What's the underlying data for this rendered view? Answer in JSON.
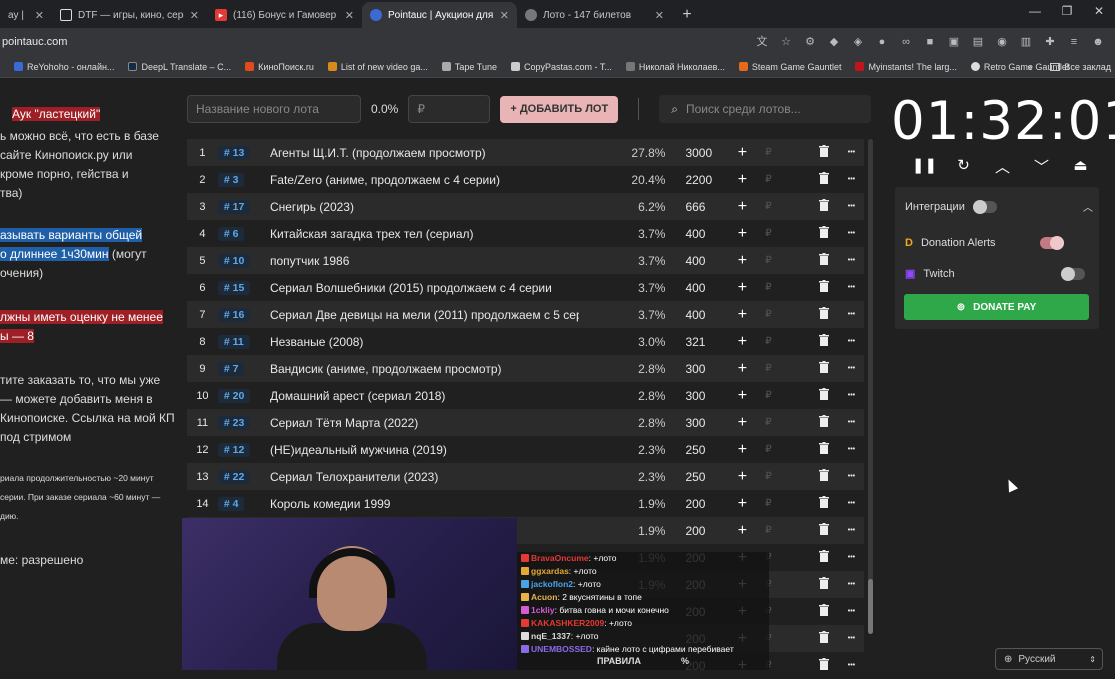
{
  "browser": {
    "tabs": [
      {
        "label": "ay |",
        "color": "#555",
        "icon": "tab-icon"
      },
      {
        "label": "DTF — игры, кино, сериалы, р",
        "color": "#222",
        "icon": "dtf-icon"
      },
      {
        "label": "(116) Бонус и Гамовер - главн",
        "color": "#e53935",
        "icon": "youtube-icon"
      },
      {
        "label": "Pointauc | Аукцион для стрим",
        "color": "#3b6ad4",
        "icon": "pointauc-icon"
      },
      {
        "label": "Лото - 147 билетов",
        "color": "#777",
        "icon": "globe-icon"
      }
    ],
    "new_tab": "+",
    "url": "pointauc.com",
    "bookmarks": [
      {
        "label": "ReYohoho - онлайн...",
        "color": "#3b6ad4"
      },
      {
        "label": "DeepL Translate – С...",
        "color": "#0f2b46"
      },
      {
        "label": "КиноПоиск.ru",
        "color": "#e34a1b"
      },
      {
        "label": "List of new video ga...",
        "color": "#d98b1a"
      },
      {
        "label": "Tape Tune",
        "color": "#aaa"
      },
      {
        "label": "CopyPastas.com - T...",
        "color": "#ccc"
      },
      {
        "label": "Николай Николаев...",
        "color": "#777"
      },
      {
        "label": "Steam Game Gauntlet",
        "color": "#e56a1b"
      },
      {
        "label": "Myinstants! The larg...",
        "color": "#c0161b"
      },
      {
        "label": "Retro Game Gauntlet",
        "color": "#ddd"
      }
    ],
    "bookmarks_more": "»",
    "all_bookmarks": "Все заклад"
  },
  "rules": {
    "title": "Аук \"ластецкий\"",
    "l1": "ь можно всё, что есть в базе",
    "l2": "сайте Кинопоиск.ру или",
    "l3": "кроме порно, гейства и",
    "l4": "тва)",
    "l5": "азывать варианты общей",
    "l6": "о длиннее 1ч30мин",
    "l6b": " (могут",
    "l7": "очения)",
    "l8": "лжны иметь оценку не менее",
    "l9": "ы — 8",
    "l10": "тите заказать то, что мы уже",
    "l11": "— можете добавить меня в",
    "l12": "Кинопоиске. Ссылка на мой КП",
    "l13": "под стримом",
    "s1": "риала продолжительностью ~20 минут",
    "s2": "серии. При заказе сериала ~60 минут —",
    "s3": "дию.",
    "l14": "ме: разрешено"
  },
  "toolbar": {
    "name_placeholder": "Название нового лота",
    "percent": "0.0%",
    "amount_placeholder": "₽",
    "add_button": "+ ДОБАВИТЬ ЛОТ",
    "search_placeholder": "Поиск среди лотов..."
  },
  "lots": [
    {
      "idx": "1",
      "id": "# 13",
      "name": "Агенты Щ.И.Т. (продолжаем просмотр)",
      "pct": "27.8%",
      "amount": "3000"
    },
    {
      "idx": "2",
      "id": "# 3",
      "name": "Fate/Zero (аниме, продолжаем с 4 серии)",
      "pct": "20.4%",
      "amount": "2200"
    },
    {
      "idx": "3",
      "id": "# 17",
      "name": "Снегирь (2023)",
      "pct": "6.2%",
      "amount": "666"
    },
    {
      "idx": "4",
      "id": "# 6",
      "name": "Китайская загадка трех тел (сериал)",
      "pct": "3.7%",
      "amount": "400"
    },
    {
      "idx": "5",
      "id": "# 10",
      "name": "попутчик 1986",
      "pct": "3.7%",
      "amount": "400"
    },
    {
      "idx": "6",
      "id": "# 15",
      "name": "Сериал Волшебники (2015) продолжаем с 4 серии",
      "pct": "3.7%",
      "amount": "400"
    },
    {
      "idx": "7",
      "id": "# 16",
      "name": "Сериал Две девицы на мели (2011) продолжаем с 5 сери",
      "pct": "3.7%",
      "amount": "400"
    },
    {
      "idx": "8",
      "id": "# 11",
      "name": "Незваные (2008)",
      "pct": "3.0%",
      "amount": "321"
    },
    {
      "idx": "9",
      "id": "# 7",
      "name": "Вандисик (аниме, продолжаем просмотр)",
      "pct": "2.8%",
      "amount": "300"
    },
    {
      "idx": "10",
      "id": "# 20",
      "name": "Домашний арест (сериал 2018)",
      "pct": "2.8%",
      "amount": "300"
    },
    {
      "idx": "11",
      "id": "# 23",
      "name": "Сериал Тётя Марта (2022)",
      "pct": "2.8%",
      "amount": "300"
    },
    {
      "idx": "12",
      "id": "# 12",
      "name": "(НЕ)идеальный мужчина (2019)",
      "pct": "2.3%",
      "amount": "250"
    },
    {
      "idx": "13",
      "id": "# 22",
      "name": "Сериал Телохранители (2023)",
      "pct": "2.3%",
      "amount": "250"
    },
    {
      "idx": "14",
      "id": "# 4",
      "name": "Король комедии 1999",
      "pct": "1.9%",
      "amount": "200"
    },
    {
      "idx": "",
      "id": "",
      "name": "",
      "pct": "1.9%",
      "amount": "200"
    },
    {
      "idx": "",
      "id": "",
      "name": "",
      "pct": "1.9%",
      "amount": "200"
    },
    {
      "idx": "",
      "id": "",
      "name": "",
      "pct": "1.9%",
      "amount": "200"
    },
    {
      "idx": "",
      "id": "",
      "name": "",
      "pct": "",
      "amount": "200"
    },
    {
      "idx": "",
      "id": "",
      "name": "",
      "pct": "",
      "amount": "200"
    },
    {
      "idx": "",
      "id": "",
      "name": "",
      "pct": "",
      "amount": "200"
    }
  ],
  "row_glyphs": {
    "plus": "+",
    "rub": "₽",
    "more": "•••"
  },
  "timer": {
    "value": "01:32:01"
  },
  "integrations": {
    "title": "Интеграции",
    "donation_alerts": "Donation Alerts",
    "twitch": "Twitch",
    "donate_pay": "DONATE PAY"
  },
  "chat": [
    {
      "user": "BravaOncume",
      "text": "+лото",
      "color": "#e53935"
    },
    {
      "user": "ggxardas",
      "text": "+лото",
      "color": "#e5a835"
    },
    {
      "user": "jackoflon2",
      "text": "+лото",
      "color": "#4aa3e8"
    },
    {
      "user": "Acuon",
      "text": "2 вкуснятины в топе",
      "color": "#e8b44a"
    },
    {
      "user": "1ckliy",
      "text": "битва говна и мочи конечно",
      "color": "#d45cd4"
    },
    {
      "user": "KAKASHKER2009",
      "text": "+лото",
      "color": "#e53935"
    },
    {
      "user": "nqE_1337",
      "text": "+лото",
      "color": "#ddd"
    },
    {
      "user": "UNEMBOSSED",
      "text": "кайне лото с цифрами перебивает",
      "color": "#8a6ae8"
    }
  ],
  "chat_bar": {
    "rules": "ПРАВИЛА",
    "pct": "%"
  },
  "language": "Русский"
}
